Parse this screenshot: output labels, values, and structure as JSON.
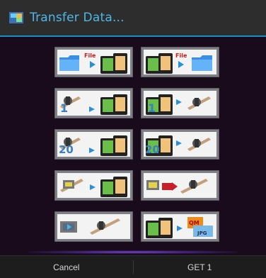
{
  "dialog": {
    "title": "Transfer Data...",
    "buttons": {
      "cancel": "Cancel",
      "get": "GET 1"
    }
  },
  "tiles": [
    {
      "id": "file-to-device",
      "label": "File",
      "icon": "folder-to-device"
    },
    {
      "id": "device-to-file",
      "label": "File",
      "icon": "device-to-folder"
    },
    {
      "id": "caliper-1-to-device",
      "label": "1",
      "icon": "caliper-to-device"
    },
    {
      "id": "device-1-to-caliper",
      "label": "1",
      "icon": "device-to-caliper"
    },
    {
      "id": "caliper-20-to-device",
      "label": "20",
      "icon": "caliper-to-device"
    },
    {
      "id": "device-20-to-caliper",
      "label": "20",
      "icon": "device-to-caliper"
    },
    {
      "id": "chip-caliper-to-device",
      "label": "",
      "icon": "chip-caliper-to-device"
    },
    {
      "id": "chip-device-to-caliper",
      "label": "",
      "icon": "chip-device-to-caliper"
    },
    {
      "id": "chip-to-caliper",
      "label": "",
      "icon": "chip-to-caliper"
    },
    {
      "id": "device-to-qm-jpg",
      "label": "QM JPG",
      "icon": "device-to-image"
    }
  ],
  "colors": {
    "accent": "#4db8e8",
    "tile_border": "#7f7f86",
    "arrow": "#2a8fd8",
    "background": "#190b1c"
  }
}
